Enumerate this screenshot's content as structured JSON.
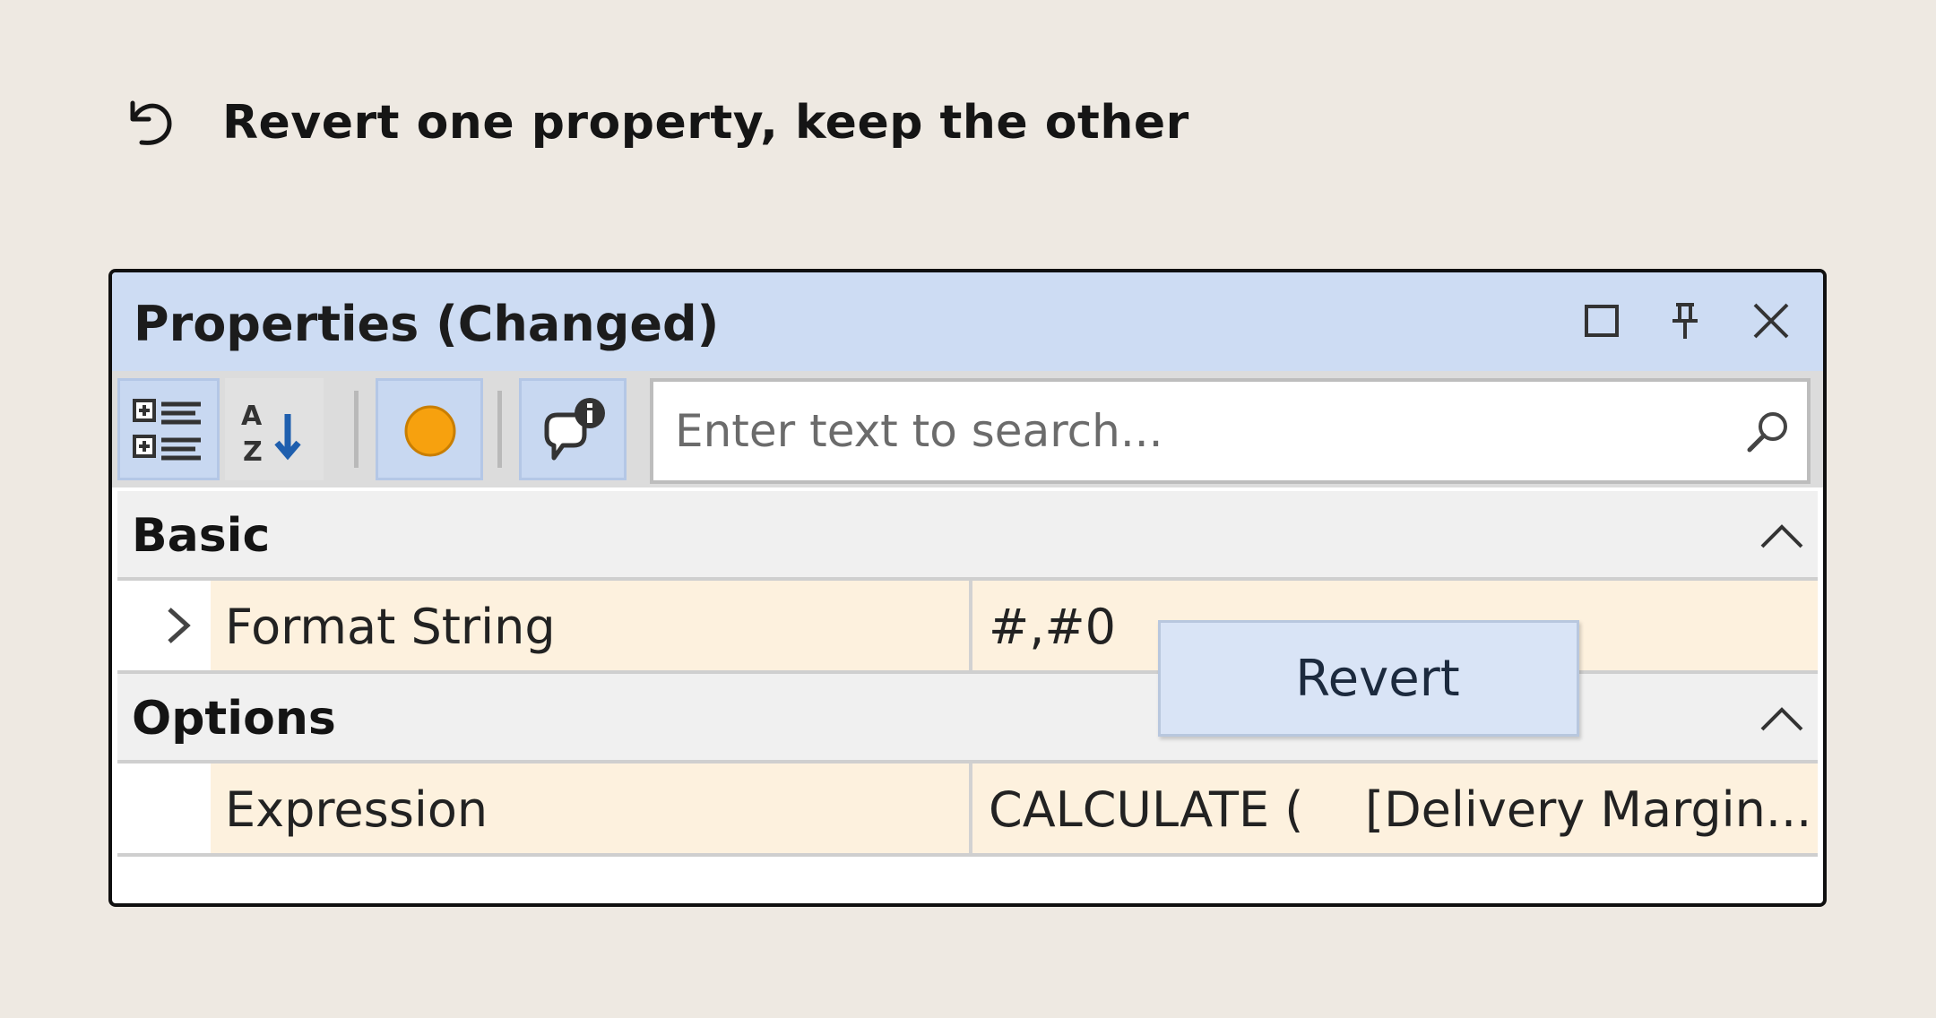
{
  "heading": {
    "icon": "undo-icon",
    "text": "Revert one property, keep the other"
  },
  "panel": {
    "title": "Properties (Changed)",
    "title_buttons": [
      "maximize-icon",
      "pin-icon",
      "close-icon"
    ],
    "toolbar": {
      "buttons": [
        {
          "name": "categorized-view-icon",
          "active": true
        },
        {
          "name": "sort-alphabetical-icon",
          "active": false
        },
        {
          "name": "changed-filter-dot-icon",
          "active": true,
          "color": "#f7a10e"
        },
        {
          "name": "description-info-icon",
          "active": true
        }
      ],
      "search": {
        "placeholder": "Enter text to search...",
        "value": "",
        "icon": "search-icon"
      }
    },
    "categories": [
      {
        "name": "Basic",
        "properties": [
          {
            "name": "Format String",
            "value": "#,#0",
            "expandable": true,
            "changed": true
          }
        ]
      },
      {
        "name": "Options",
        "properties": [
          {
            "name": "Expression",
            "value": "CALCULATE (    [Delivery Margin...",
            "expandable": false,
            "changed": true
          }
        ]
      }
    ],
    "changed_highlight": "#fdf1de"
  },
  "context_menu": {
    "items": [
      "Revert"
    ]
  },
  "colors": {
    "background": "#eee9e2",
    "titlebar": "#cddcf3",
    "accent_dot": "#f7a10e",
    "sort_arrow": "#1f5fae"
  }
}
